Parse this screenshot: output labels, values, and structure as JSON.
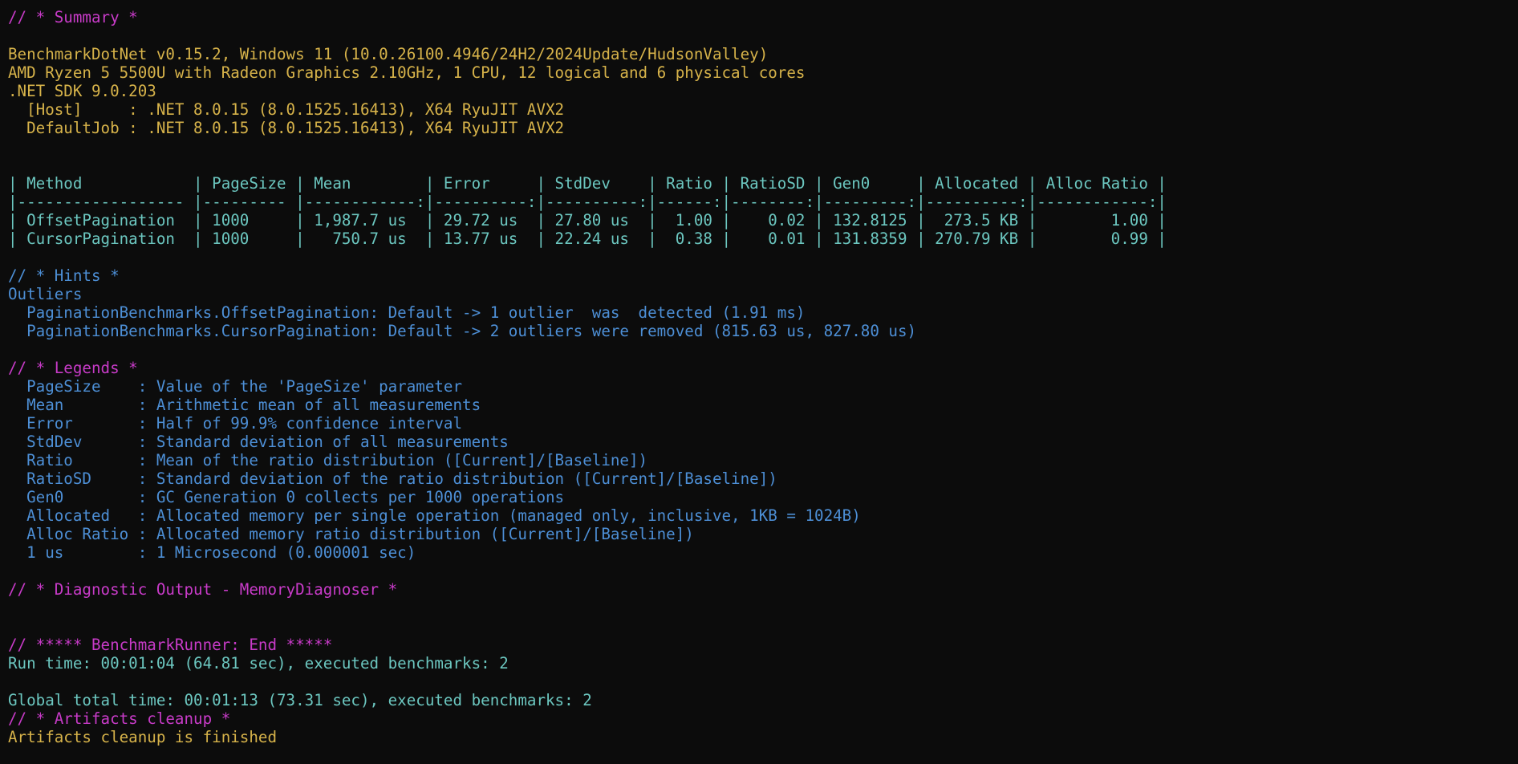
{
  "terminal": {
    "lines": [
      {
        "text": "// * Summary *",
        "color": "magenta"
      },
      {
        "text": "",
        "color": "white"
      },
      {
        "text": "BenchmarkDotNet v0.15.2, Windows 11 (10.0.26100.4946/24H2/2024Update/HudsonValley)",
        "color": "yellow"
      },
      {
        "text": "AMD Ryzen 5 5500U with Radeon Graphics 2.10GHz, 1 CPU, 12 logical and 6 physical cores",
        "color": "yellow"
      },
      {
        "text": ".NET SDK 9.0.203",
        "color": "yellow"
      },
      {
        "text": "  [Host]     : .NET 8.0.15 (8.0.1525.16413), X64 RyuJIT AVX2",
        "color": "yellow"
      },
      {
        "text": "  DefaultJob : .NET 8.0.15 (8.0.1525.16413), X64 RyuJIT AVX2",
        "color": "yellow"
      },
      {
        "text": "",
        "color": "white"
      },
      {
        "text": "",
        "color": "white"
      },
      {
        "text": "| Method            | PageSize | Mean        | Error     | StdDev    | Ratio | RatioSD | Gen0     | Allocated | Alloc Ratio |",
        "color": "teal"
      },
      {
        "text": "|------------------ |--------- |------------:|----------:|----------:|------:|--------:|---------:|----------:|------------:|",
        "color": "teal"
      },
      {
        "text": "| OffsetPagination  | 1000     | 1,987.7 us  | 29.72 us  | 27.80 us  |  1.00 |    0.02 | 132.8125 |  273.5 KB |        1.00 |",
        "color": "teal"
      },
      {
        "text": "| CursorPagination  | 1000     |   750.7 us  | 13.77 us  | 22.24 us  |  0.38 |    0.01 | 131.8359 | 270.79 KB |        0.99 |",
        "color": "teal"
      },
      {
        "text": "",
        "color": "white"
      },
      {
        "text": "// * Hints *",
        "color": "blue"
      },
      {
        "text": "Outliers",
        "color": "blue"
      },
      {
        "text": "  PaginationBenchmarks.OffsetPagination: Default -> 1 outlier  was  detected (1.91 ms)",
        "color": "blue"
      },
      {
        "text": "  PaginationBenchmarks.CursorPagination: Default -> 2 outliers were removed (815.63 us, 827.80 us)",
        "color": "blue"
      },
      {
        "text": "",
        "color": "white"
      },
      {
        "text": "// * Legends *",
        "color": "magenta"
      },
      {
        "text": "  PageSize    : Value of the 'PageSize' parameter",
        "color": "blue"
      },
      {
        "text": "  Mean        : Arithmetic mean of all measurements",
        "color": "blue"
      },
      {
        "text": "  Error       : Half of 99.9% confidence interval",
        "color": "blue"
      },
      {
        "text": "  StdDev      : Standard deviation of all measurements",
        "color": "blue"
      },
      {
        "text": "  Ratio       : Mean of the ratio distribution ([Current]/[Baseline])",
        "color": "blue"
      },
      {
        "text": "  RatioSD     : Standard deviation of the ratio distribution ([Current]/[Baseline])",
        "color": "blue"
      },
      {
        "text": "  Gen0        : GC Generation 0 collects per 1000 operations",
        "color": "blue"
      },
      {
        "text": "  Allocated   : Allocated memory per single operation (managed only, inclusive, 1KB = 1024B)",
        "color": "blue"
      },
      {
        "text": "  Alloc Ratio : Allocated memory ratio distribution ([Current]/[Baseline])",
        "color": "blue"
      },
      {
        "text": "  1 us        : 1 Microsecond (0.000001 sec)",
        "color": "blue"
      },
      {
        "text": "",
        "color": "white"
      },
      {
        "text": "// * Diagnostic Output - MemoryDiagnoser *",
        "color": "magenta"
      },
      {
        "text": "",
        "color": "white"
      },
      {
        "text": "",
        "color": "white"
      },
      {
        "text": "// ***** BenchmarkRunner: End *****",
        "color": "magenta"
      },
      {
        "text": "Run time: 00:01:04 (64.81 sec), executed benchmarks: 2",
        "color": "teal"
      },
      {
        "text": "",
        "color": "white"
      },
      {
        "text": "Global total time: 00:01:13 (73.31 sec), executed benchmarks: 2",
        "color": "teal"
      },
      {
        "text": "// * Artifacts cleanup *",
        "color": "magenta"
      },
      {
        "text": "Artifacts cleanup is finished",
        "color": "yellow"
      }
    ]
  }
}
